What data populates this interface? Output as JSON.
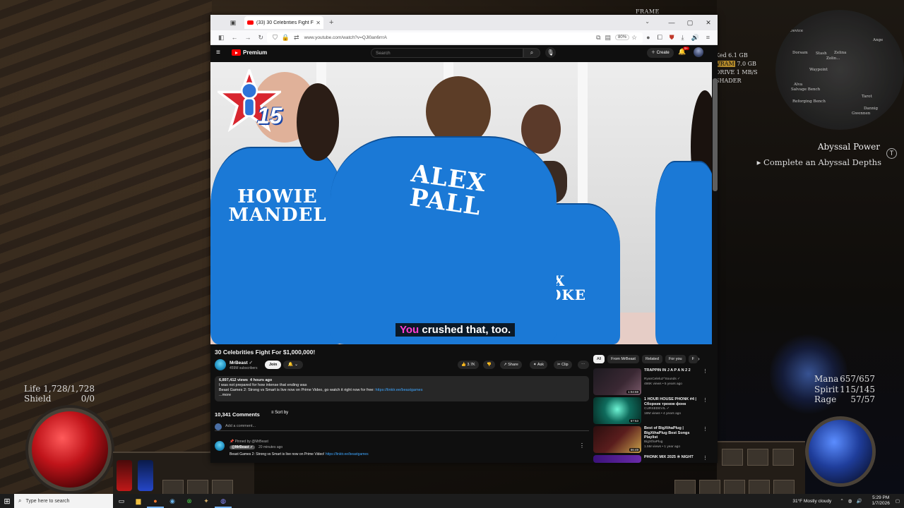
{
  "game": {
    "frame_label": "FRAME",
    "stats_lines": [
      {
        "plain": "",
        "hl": "VRAM",
        "rest": "7.0 GB"
      },
      {
        "plain": "DRIVE 1 MB/S",
        "hl": "",
        "rest": ""
      },
      {
        "plain": "SHADER",
        "hl": "",
        "rest": ""
      }
    ],
    "stats_top": "Ked 6.1 GB",
    "map_labels": [
      "Map Device",
      "Dorsam",
      "Stash",
      "Zelina",
      "Zolin...",
      "Waypoint",
      "Alva",
      "Salvage Bench",
      "Reforging Bench",
      "Tarot",
      "Dannig",
      "Gwennen",
      "Ange"
    ],
    "quest": {
      "title": "Abyssal Power",
      "icon": "T",
      "objective": "Complete an Abyssal Depths"
    },
    "left_stats": [
      {
        "label": "Life",
        "value": "1,728/1,728"
      },
      {
        "label": "Shield",
        "value": "0/0"
      }
    ],
    "right_stats": [
      {
        "label": "Mana",
        "value": "657/657"
      },
      {
        "label": "Spirit",
        "value": "115/145"
      },
      {
        "label": "Rage",
        "value": "57/57"
      }
    ]
  },
  "browser": {
    "tab_title": "(33) 30 Celebrities Fight For $1,0",
    "url": "www.youtube.com/watch?v=QJl0an6rrrA",
    "zoom": "80%",
    "win_min": "—",
    "win_max": "▢",
    "win_close": "✕",
    "new_tab": "+",
    "tab_close": "✕"
  },
  "youtube": {
    "brand": "Premium",
    "search_placeholder": "Search",
    "create_label": "Create",
    "notif_count": "9+",
    "video": {
      "badge_number": "15",
      "jersey_left": "HOWIE\nMANDEL",
      "jersey_center": "ALEX\nPALL",
      "jersey_right": "ALEX\nBROOKE",
      "subtitle_hl": "You",
      "subtitle_rest": " crushed that, too."
    },
    "title": "30 Celebrities Fight For $1,000,000!",
    "channel": {
      "name": "MrBeast",
      "verified": "✓",
      "subs": "459M subscribers",
      "join": "Join",
      "bell": "🔔 ⌄"
    },
    "actions": {
      "likes": "👍 3.7K",
      "dislike": "👎",
      "share": "↗ Share",
      "ask": "✦ Ask",
      "clip": "✂ Clip",
      "more": "⋯"
    },
    "description": {
      "views": "6,897,412 views",
      "time": "4 hours ago",
      "line1": "I was not prepared for how intense that ending was",
      "line2": "Beast Games 2: Strong vs Smart is live now on Prime Video, go watch it right now for free:",
      "link": "https://linktr.ee/beastgames",
      "more": "...more"
    },
    "comments": {
      "count": "10,341 Comments",
      "sort": "Sort by",
      "add_placeholder": "Add a comment...",
      "pinned_label": "📌 Pinned by @MrBeast",
      "pinned_author": "@MrBeast ✓",
      "pinned_time": "20 minutes ago",
      "pinned_text": "Beast Games 2: Strong vs Smart is live now on Prime Video!",
      "pinned_link": "https://linktr.ee/beastgames"
    },
    "chips": [
      "All",
      "From MrBeast",
      "Related",
      "For you",
      "F"
    ],
    "recommendations": [
      {
        "title": "TRAPPIN IN J A P A N 2 2",
        "channel": "RyanCeleluz^Sounds ✓",
        "meta": "486K views • 5 years ago",
        "duration": "1:04:59",
        "thumb": "#3a2833"
      },
      {
        "title": "1 HOUR HOUSE PHONK #4 | Сборник треков фонк",
        "channel": "CURSEDEVIL ✓",
        "meta": "18M views • 4 years ago",
        "duration": "57:53",
        "thumb": "#0f6b5c"
      },
      {
        "title": "Best of BigXthaPlug | BigXthaPlug Best Songs Playlist",
        "channel": "BigXthaPlug",
        "meta": "1.5M views • 1 year ago",
        "duration": "56:49",
        "thumb": "#5a1d1d"
      },
      {
        "title": "PHONK MIX 2025 ※ NIGHT",
        "channel": "",
        "meta": "",
        "duration": "",
        "thumb": "#6a2aa8"
      }
    ]
  },
  "taskbar": {
    "search_placeholder": "Type here to search",
    "weather": "31°F  Mostly cloudy",
    "time": "5:29 PM",
    "date": "1/7/2026"
  }
}
